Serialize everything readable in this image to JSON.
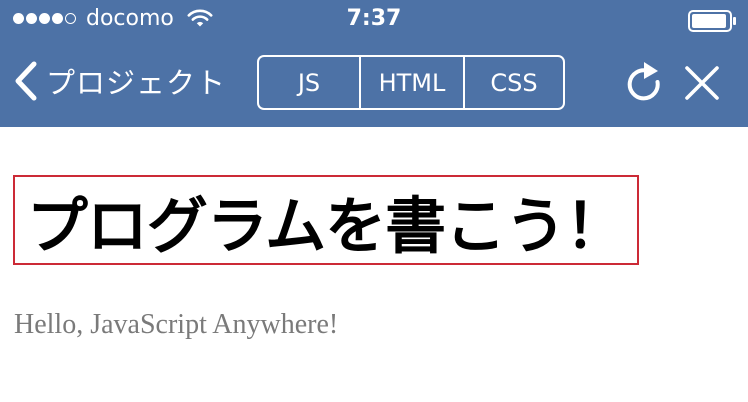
{
  "status_bar": {
    "signal_bars": 5,
    "signal_filled": 4,
    "carrier": "docomo",
    "time": "7:37",
    "wifi_icon": "wifi-icon",
    "battery_icon": "battery-icon"
  },
  "nav": {
    "back_label": "プロジェクト",
    "back_icon": "chevron-left-icon",
    "tabs": [
      {
        "label": "JS"
      },
      {
        "label": "HTML"
      },
      {
        "label": "CSS"
      }
    ],
    "reload_icon": "reload-icon",
    "close_icon": "close-icon"
  },
  "content": {
    "heading": "プログラムを書こう！",
    "paragraph": "Hello, JavaScript Anywhere!"
  },
  "colors": {
    "nav_background": "#4d72a6",
    "heading_border": "#cc2a36",
    "paragraph_text": "#7a7a7a"
  }
}
